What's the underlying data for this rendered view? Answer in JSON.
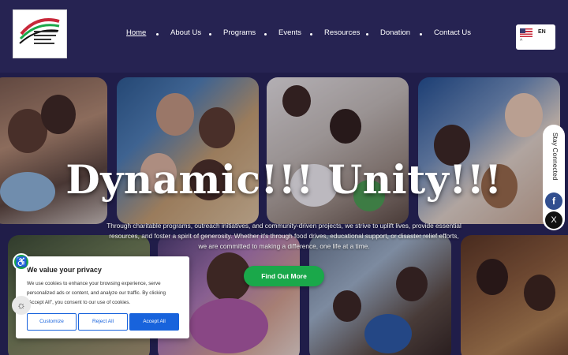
{
  "header": {
    "logo_alt": "Dynamic International Charitable Club of Bahrain",
    "nav": [
      {
        "label": "Home",
        "active": true
      },
      {
        "label": "About Us",
        "active": false
      },
      {
        "label": "Programs",
        "active": false
      },
      {
        "label": "Events",
        "active": false
      },
      {
        "label": "Resources",
        "active": false
      },
      {
        "label": "Donation",
        "active": false
      },
      {
        "label": "Contact Us",
        "active": false
      }
    ],
    "language": {
      "code": "EN",
      "caret": "^",
      "flag_icon": "us-flag-icon"
    }
  },
  "hero": {
    "headline": "Dynamic!!! Unity!!!",
    "body": "Through charitable programs, outreach initiatives, and community-driven projects, we strive to uplift lives, provide essential resources, and foster a spirit of generosity. Whether it's through food drives, educational support, or disaster relief efforts, we are committed to making a difference, one life at a time.",
    "cta_label": "Find Out More",
    "cta_color": "#1aa84a"
  },
  "social": {
    "label": "Stay Connected",
    "facebook_glyph": "f",
    "x_glyph": "X"
  },
  "accessibility": {
    "icon": "accessibility-icon",
    "glyph": "♿"
  },
  "theme_toggle": {
    "icon": "sun-icon",
    "glyph": "☼"
  },
  "cookie_banner": {
    "title": "We value your privacy",
    "text": "We use cookies to enhance your browsing experience, serve personalized ads or content, and analyze our traffic. By clicking \"Accept All\", you consent to our use of cookies.",
    "buttons": {
      "customize": "Customize",
      "reject": "Reject All",
      "accept": "Accept All"
    },
    "accent": "#1863dc"
  },
  "colors": {
    "page_bg": "#252250",
    "header_bg": "#262352"
  }
}
